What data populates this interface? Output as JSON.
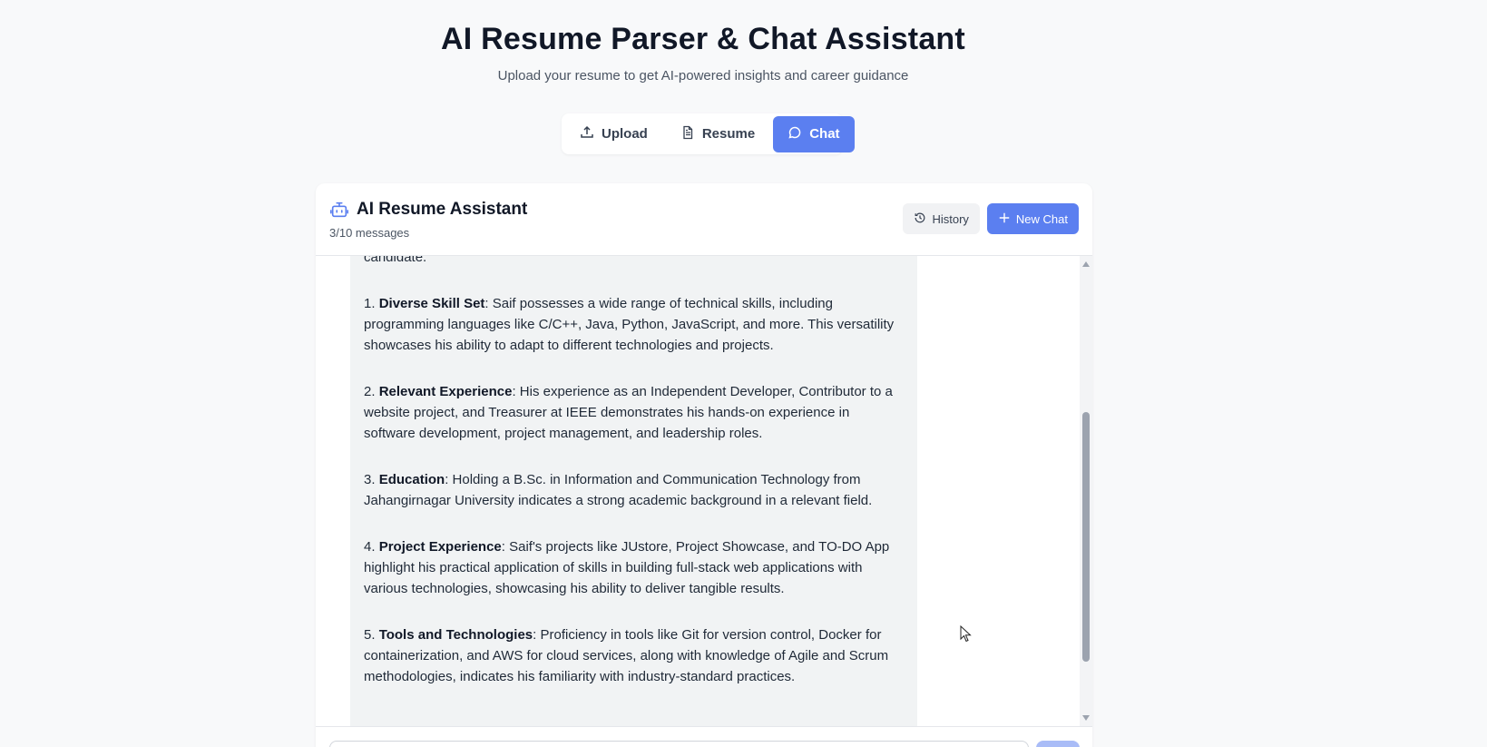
{
  "header": {
    "title": "AI Resume Parser & Chat Assistant",
    "subtitle": "Upload your resume to get AI-powered insights and career guidance"
  },
  "tabs": [
    {
      "label": "Upload",
      "icon": "upload-icon",
      "active": false
    },
    {
      "label": "Resume",
      "icon": "document-icon",
      "active": false
    },
    {
      "label": "Chat",
      "icon": "chat-bubble-icon",
      "active": true
    }
  ],
  "chat": {
    "title": "AI Resume Assistant",
    "message_count": "3/10 messages",
    "history_label": "History",
    "new_chat_label": "New Chat",
    "message": {
      "intro_fragment": "candidate.",
      "items": [
        {
          "num": "1.",
          "heading": "Diverse Skill Set",
          "text": ": Saif possesses a wide range of technical skills, including programming languages like C/C++, Java, Python, JavaScript, and more. This versatility showcases his ability to adapt to different technologies and projects."
        },
        {
          "num": "2.",
          "heading": "Relevant Experience",
          "text": ": His experience as an Independent Developer, Contributor to a website project, and Treasurer at IEEE demonstrates his hands-on experience in software development, project management, and leadership roles."
        },
        {
          "num": "3.",
          "heading": "Education",
          "text": ": Holding a B.Sc. in Information and Communication Technology from Jahangirnagar University indicates a strong academic background in a relevant field."
        },
        {
          "num": "4.",
          "heading": "Project Experience",
          "text": ": Saif's projects like JUstore, Project Showcase, and TO-DO App highlight his practical application of skills in building full-stack web applications with various technologies, showcasing his ability to deliver tangible results."
        },
        {
          "num": "5.",
          "heading": "Tools and Technologies",
          "text": ": Proficiency in tools like Git for version control, Docker for containerization, and AWS for cloud services, along with knowledge of Agile and Scrum methodologies, indicates his familiarity with industry-standard practices."
        }
      ]
    },
    "input_placeholder": ""
  },
  "colors": {
    "accent": "#5b7ff0",
    "background": "#f8f9fa",
    "bubble": "#f1f3f4"
  }
}
